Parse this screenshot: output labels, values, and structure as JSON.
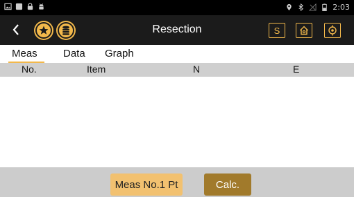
{
  "status_bar": {
    "time": "2:03",
    "left_icons": [
      "image-icon",
      "square-icon",
      "lock-icon",
      "android-icon"
    ],
    "right_icons": [
      "location-icon",
      "bluetooth-icon",
      "no-signal-icon",
      "battery-icon"
    ]
  },
  "app_bar": {
    "title": "Resection",
    "back_icon": "back-chevron-icon",
    "left_buttons": [
      "star-icon",
      "coins-icon"
    ],
    "right_buttons": [
      {
        "icon": "s-icon",
        "label": "S"
      },
      {
        "icon": "home-settings-icon",
        "label": ""
      },
      {
        "icon": "target-icon",
        "label": ""
      }
    ]
  },
  "tabs": [
    {
      "label": "Meas",
      "active": true
    },
    {
      "label": "Data",
      "active": false
    },
    {
      "label": "Graph",
      "active": false
    }
  ],
  "table": {
    "columns": [
      "No.",
      "Item",
      "N",
      "E"
    ],
    "rows": []
  },
  "bottom": {
    "meas_button": "Meas No.1 Pt",
    "calc_button": "Calc."
  },
  "colors": {
    "accent": "#f2b84b",
    "appbar_bg": "#1b1b1b",
    "header_bg": "#cfcfcf",
    "bottombar_bg": "#cccccc",
    "meas_button_bg": "#f2c170",
    "calc_button_bg": "#a17a2b"
  }
}
